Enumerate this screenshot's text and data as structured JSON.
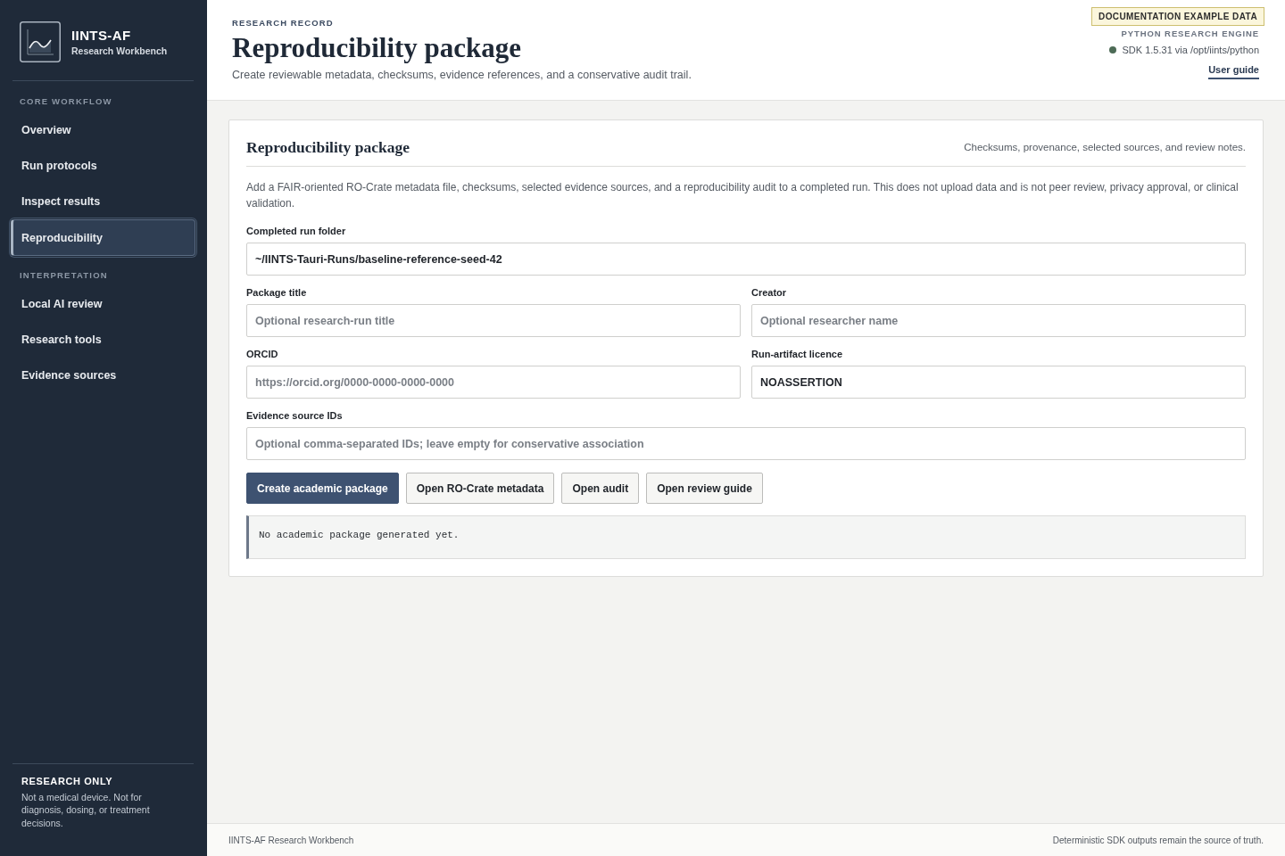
{
  "sidebar": {
    "brand": {
      "title": "IINTS-AF",
      "subtitle": "Research Workbench"
    },
    "sections": [
      {
        "heading": "CORE WORKFLOW",
        "items": [
          {
            "label": "Overview",
            "selected": false
          },
          {
            "label": "Run protocols",
            "selected": false
          },
          {
            "label": "Inspect results",
            "selected": false
          },
          {
            "label": "Reproducibility",
            "selected": true
          }
        ]
      },
      {
        "heading": "INTERPRETATION",
        "items": [
          {
            "label": "Local AI review",
            "selected": false
          },
          {
            "label": "Research tools",
            "selected": false
          },
          {
            "label": "Evidence sources",
            "selected": false
          }
        ]
      }
    ],
    "notice": {
      "title": "RESEARCH ONLY",
      "text": "Not a medical device. Not for diagnosis, dosing, or treatment decisions."
    }
  },
  "header": {
    "eyebrow": "RESEARCH RECORD",
    "title": "Reproducibility package",
    "subtitle": "Create reviewable metadata, checksums, evidence references, and a conservative audit trail.",
    "badge": "DOCUMENTATION EXAMPLE DATA",
    "engine": {
      "label": "PYTHON RESEARCH ENGINE",
      "status": "SDK 1.5.31 via /opt/iints/python",
      "connected": true
    },
    "link": "User guide"
  },
  "card": {
    "title": "Reproducibility package",
    "summary": "Checksums, provenance, selected sources, and review notes.",
    "description": "Add a FAIR-oriented RO-Crate metadata file, checksums, selected evidence sources, and a reproducibility audit to a completed run. This does not upload data and is not peer review, privacy approval, or clinical validation.",
    "field_rows": [
      [
        {
          "label": "Completed run folder",
          "value": "~/IINTS-Tauri-Runs/baseline-reference-seed-42"
        }
      ],
      [
        {
          "label": "Package title",
          "placeholder": "Optional research-run title"
        },
        {
          "label": "Creator",
          "placeholder": "Optional researcher name"
        }
      ],
      [
        {
          "label": "ORCID",
          "placeholder": "https://orcid.org/0000-0000-0000-0000"
        },
        {
          "label": "Run-artifact licence",
          "value": "NOASSERTION"
        }
      ],
      [
        {
          "label": "Evidence source IDs",
          "placeholder": "Optional comma-separated IDs; leave empty for conservative association"
        }
      ]
    ],
    "actions": [
      {
        "label": "Create academic package",
        "primary": true
      },
      {
        "label": "Open RO-Crate metadata",
        "primary": false
      },
      {
        "label": "Open audit",
        "primary": false
      },
      {
        "label": "Open review guide",
        "primary": false
      }
    ],
    "output": "No academic package generated yet."
  },
  "footer": {
    "left": "IINTS-AF Research Workbench",
    "right": "Deterministic SDK outputs remain the source of truth."
  }
}
